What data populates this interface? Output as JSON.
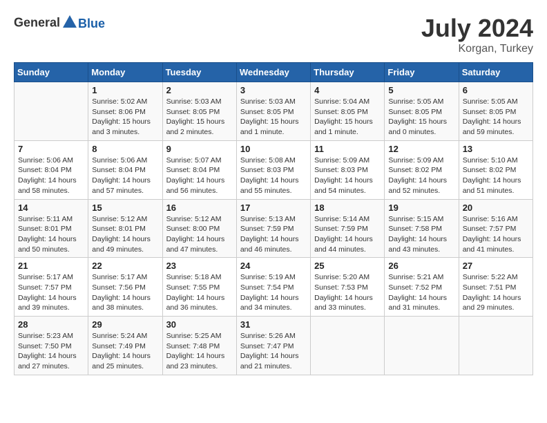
{
  "header": {
    "logo_general": "General",
    "logo_blue": "Blue",
    "month": "July 2024",
    "location": "Korgan, Turkey"
  },
  "calendar": {
    "weekdays": [
      "Sunday",
      "Monday",
      "Tuesday",
      "Wednesday",
      "Thursday",
      "Friday",
      "Saturday"
    ],
    "weeks": [
      [
        {
          "day": "",
          "sunrise": "",
          "sunset": "",
          "daylight": ""
        },
        {
          "day": "1",
          "sunrise": "Sunrise: 5:02 AM",
          "sunset": "Sunset: 8:06 PM",
          "daylight": "Daylight: 15 hours and 3 minutes."
        },
        {
          "day": "2",
          "sunrise": "Sunrise: 5:03 AM",
          "sunset": "Sunset: 8:05 PM",
          "daylight": "Daylight: 15 hours and 2 minutes."
        },
        {
          "day": "3",
          "sunrise": "Sunrise: 5:03 AM",
          "sunset": "Sunset: 8:05 PM",
          "daylight": "Daylight: 15 hours and 1 minute."
        },
        {
          "day": "4",
          "sunrise": "Sunrise: 5:04 AM",
          "sunset": "Sunset: 8:05 PM",
          "daylight": "Daylight: 15 hours and 1 minute."
        },
        {
          "day": "5",
          "sunrise": "Sunrise: 5:05 AM",
          "sunset": "Sunset: 8:05 PM",
          "daylight": "Daylight: 15 hours and 0 minutes."
        },
        {
          "day": "6",
          "sunrise": "Sunrise: 5:05 AM",
          "sunset": "Sunset: 8:05 PM",
          "daylight": "Daylight: 14 hours and 59 minutes."
        }
      ],
      [
        {
          "day": "7",
          "sunrise": "Sunrise: 5:06 AM",
          "sunset": "Sunset: 8:04 PM",
          "daylight": "Daylight: 14 hours and 58 minutes."
        },
        {
          "day": "8",
          "sunrise": "Sunrise: 5:06 AM",
          "sunset": "Sunset: 8:04 PM",
          "daylight": "Daylight: 14 hours and 57 minutes."
        },
        {
          "day": "9",
          "sunrise": "Sunrise: 5:07 AM",
          "sunset": "Sunset: 8:04 PM",
          "daylight": "Daylight: 14 hours and 56 minutes."
        },
        {
          "day": "10",
          "sunrise": "Sunrise: 5:08 AM",
          "sunset": "Sunset: 8:03 PM",
          "daylight": "Daylight: 14 hours and 55 minutes."
        },
        {
          "day": "11",
          "sunrise": "Sunrise: 5:09 AM",
          "sunset": "Sunset: 8:03 PM",
          "daylight": "Daylight: 14 hours and 54 minutes."
        },
        {
          "day": "12",
          "sunrise": "Sunrise: 5:09 AM",
          "sunset": "Sunset: 8:02 PM",
          "daylight": "Daylight: 14 hours and 52 minutes."
        },
        {
          "day": "13",
          "sunrise": "Sunrise: 5:10 AM",
          "sunset": "Sunset: 8:02 PM",
          "daylight": "Daylight: 14 hours and 51 minutes."
        }
      ],
      [
        {
          "day": "14",
          "sunrise": "Sunrise: 5:11 AM",
          "sunset": "Sunset: 8:01 PM",
          "daylight": "Daylight: 14 hours and 50 minutes."
        },
        {
          "day": "15",
          "sunrise": "Sunrise: 5:12 AM",
          "sunset": "Sunset: 8:01 PM",
          "daylight": "Daylight: 14 hours and 49 minutes."
        },
        {
          "day": "16",
          "sunrise": "Sunrise: 5:12 AM",
          "sunset": "Sunset: 8:00 PM",
          "daylight": "Daylight: 14 hours and 47 minutes."
        },
        {
          "day": "17",
          "sunrise": "Sunrise: 5:13 AM",
          "sunset": "Sunset: 7:59 PM",
          "daylight": "Daylight: 14 hours and 46 minutes."
        },
        {
          "day": "18",
          "sunrise": "Sunrise: 5:14 AM",
          "sunset": "Sunset: 7:59 PM",
          "daylight": "Daylight: 14 hours and 44 minutes."
        },
        {
          "day": "19",
          "sunrise": "Sunrise: 5:15 AM",
          "sunset": "Sunset: 7:58 PM",
          "daylight": "Daylight: 14 hours and 43 minutes."
        },
        {
          "day": "20",
          "sunrise": "Sunrise: 5:16 AM",
          "sunset": "Sunset: 7:57 PM",
          "daylight": "Daylight: 14 hours and 41 minutes."
        }
      ],
      [
        {
          "day": "21",
          "sunrise": "Sunrise: 5:17 AM",
          "sunset": "Sunset: 7:57 PM",
          "daylight": "Daylight: 14 hours and 39 minutes."
        },
        {
          "day": "22",
          "sunrise": "Sunrise: 5:17 AM",
          "sunset": "Sunset: 7:56 PM",
          "daylight": "Daylight: 14 hours and 38 minutes."
        },
        {
          "day": "23",
          "sunrise": "Sunrise: 5:18 AM",
          "sunset": "Sunset: 7:55 PM",
          "daylight": "Daylight: 14 hours and 36 minutes."
        },
        {
          "day": "24",
          "sunrise": "Sunrise: 5:19 AM",
          "sunset": "Sunset: 7:54 PM",
          "daylight": "Daylight: 14 hours and 34 minutes."
        },
        {
          "day": "25",
          "sunrise": "Sunrise: 5:20 AM",
          "sunset": "Sunset: 7:53 PM",
          "daylight": "Daylight: 14 hours and 33 minutes."
        },
        {
          "day": "26",
          "sunrise": "Sunrise: 5:21 AM",
          "sunset": "Sunset: 7:52 PM",
          "daylight": "Daylight: 14 hours and 31 minutes."
        },
        {
          "day": "27",
          "sunrise": "Sunrise: 5:22 AM",
          "sunset": "Sunset: 7:51 PM",
          "daylight": "Daylight: 14 hours and 29 minutes."
        }
      ],
      [
        {
          "day": "28",
          "sunrise": "Sunrise: 5:23 AM",
          "sunset": "Sunset: 7:50 PM",
          "daylight": "Daylight: 14 hours and 27 minutes."
        },
        {
          "day": "29",
          "sunrise": "Sunrise: 5:24 AM",
          "sunset": "Sunset: 7:49 PM",
          "daylight": "Daylight: 14 hours and 25 minutes."
        },
        {
          "day": "30",
          "sunrise": "Sunrise: 5:25 AM",
          "sunset": "Sunset: 7:48 PM",
          "daylight": "Daylight: 14 hours and 23 minutes."
        },
        {
          "day": "31",
          "sunrise": "Sunrise: 5:26 AM",
          "sunset": "Sunset: 7:47 PM",
          "daylight": "Daylight: 14 hours and 21 minutes."
        },
        {
          "day": "",
          "sunrise": "",
          "sunset": "",
          "daylight": ""
        },
        {
          "day": "",
          "sunrise": "",
          "sunset": "",
          "daylight": ""
        },
        {
          "day": "",
          "sunrise": "",
          "sunset": "",
          "daylight": ""
        }
      ]
    ]
  }
}
